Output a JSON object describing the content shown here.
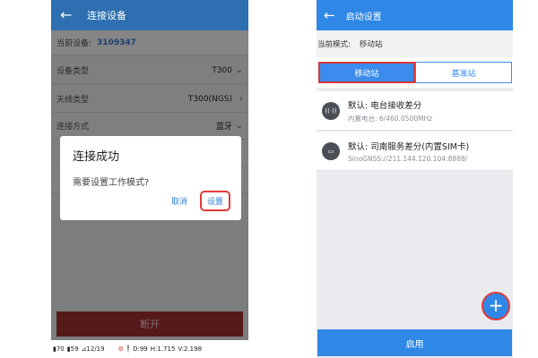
{
  "left": {
    "header": {
      "back_icon": "arrow-left-icon",
      "title": "连接设备"
    },
    "device": {
      "label": "当前设备:",
      "value": "3109347"
    },
    "rows": [
      {
        "label": "设备类型",
        "value": "T300",
        "chevron": "⌄"
      },
      {
        "label": "天线类型",
        "value": "T300(NGS)",
        "chevron": "›"
      },
      {
        "label": "连接方式",
        "value": "蓝牙",
        "chevron": "⌄"
      }
    ],
    "dialog": {
      "title": "连接成功",
      "message": "需要设置工作模式?",
      "cancel": "取消",
      "confirm": "设置"
    },
    "disconnect_label": "断开",
    "status": {
      "battery1": "▮70",
      "battery2": "▮59",
      "satellites": "⊿12/19",
      "gear_icon": "gear-icon",
      "d": "D:99",
      "h": "H:1.715",
      "v": "V:2.198"
    },
    "colors": {
      "appbar": "#2d6fb0",
      "accent": "#2f7ed8",
      "highlight": "#e23a3a"
    }
  },
  "right": {
    "header": {
      "back_icon": "arrow-left-icon",
      "title": "启动设置"
    },
    "mode": {
      "label": "当前模式:",
      "value": "移动站"
    },
    "segments": {
      "mobile": "移动站",
      "base": "基准站"
    },
    "items": [
      {
        "icon": "radio-signal-icon",
        "glyph": "((·))",
        "title": "默认: 电台接收差分",
        "subtitle": "内置电台: 6/460.0500MHz"
      },
      {
        "icon": "sim-card-icon",
        "glyph": "▭",
        "title": "默认: 司南服务差分(内置SIM卡)",
        "subtitle": "SinoGNSS://211.144.120.104:8888/"
      }
    ],
    "fab_label": "+",
    "start_label": "启用",
    "colors": {
      "appbar": "#2f87e6",
      "highlight": "#d8373b"
    }
  }
}
